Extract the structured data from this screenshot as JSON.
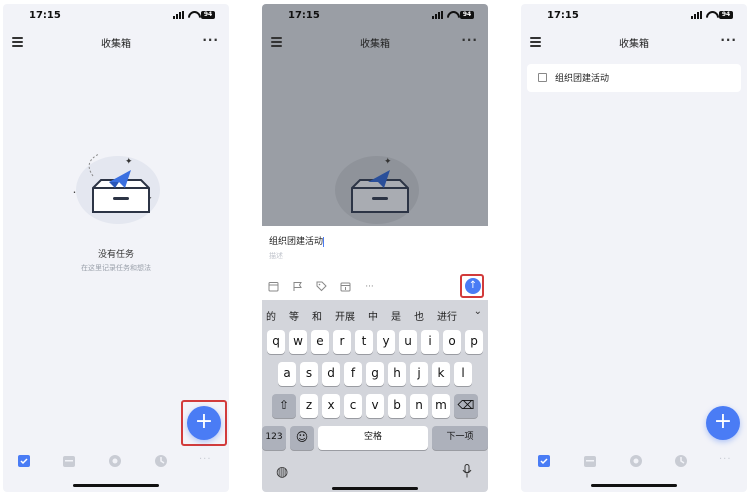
{
  "screens": [
    {
      "status": {
        "time": "17:15",
        "battery": "94"
      },
      "nav": {
        "title": "收集箱"
      },
      "empty": {
        "title": "没有任务",
        "subtitle": "在这里记录任务和想法"
      },
      "fab": "+"
    },
    {
      "status": {
        "time": "17:15",
        "battery": "94"
      },
      "nav": {
        "title": "收集箱"
      },
      "input": {
        "value": "组织团建活动",
        "placeholder": "描述"
      },
      "toolbar_more": "···",
      "candidates": [
        "的",
        "等",
        "和",
        "开展",
        "中",
        "是",
        "也",
        "进行"
      ],
      "keys_row1": [
        "q",
        "w",
        "e",
        "r",
        "t",
        "y",
        "u",
        "i",
        "o",
        "p"
      ],
      "keys_row2": [
        "a",
        "s",
        "d",
        "f",
        "g",
        "h",
        "j",
        "k",
        "l"
      ],
      "keys_row3": [
        "z",
        "x",
        "c",
        "v",
        "b",
        "n",
        "m"
      ],
      "key_numbers": "123",
      "key_space": "空格",
      "key_next": "下一项"
    },
    {
      "status": {
        "time": "17:15",
        "battery": "94"
      },
      "nav": {
        "title": "收集箱"
      },
      "task": {
        "title": "组织团建活动"
      },
      "fab": "+"
    }
  ],
  "colors": {
    "accent": "#4a7cf5",
    "highlight": "#d23b3b",
    "background": "#f2f3f8"
  },
  "icons": [
    "menu-icon",
    "more-icon",
    "inbox-illustration",
    "plus-icon",
    "calendar-icon",
    "flag-icon",
    "tag-icon",
    "template-icon",
    "send-icon",
    "globe-icon",
    "mic-icon",
    "shift-icon",
    "backspace-icon",
    "emoji-icon",
    "checkbox-tab-icon",
    "calendar-tab-icon",
    "focus-tab-icon",
    "habit-tab-icon",
    "more-tab-icon"
  ]
}
